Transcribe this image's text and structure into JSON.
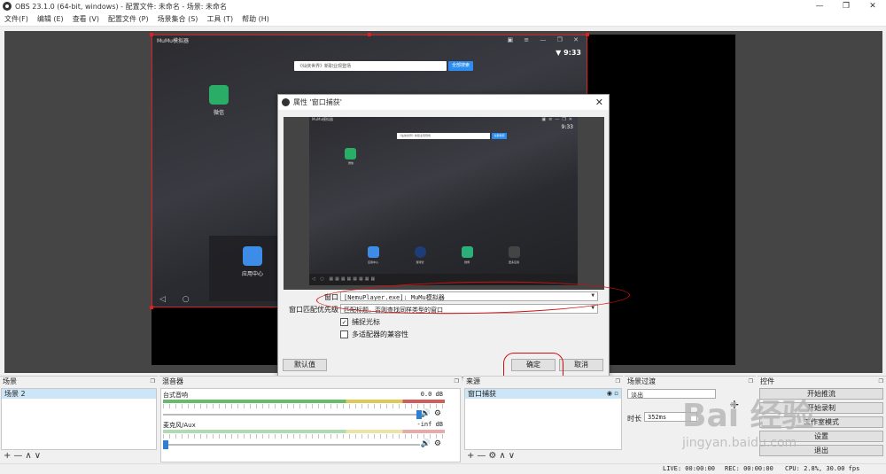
{
  "window": {
    "title": "OBS 23.1.0 (64-bit, windows) - 配置文件: 未命名 - 场景: 未命名"
  },
  "menu": [
    "文件(F)",
    "编辑 (E)",
    "查看 (V)",
    "配置文件 (P)",
    "场景集合 (S)",
    "工具 (T)",
    "帮助 (H)"
  ],
  "source_preview": {
    "app_title": "MuMu模拟器",
    "time": "9:33",
    "search_placeholder": "《仙侠世界》新职业现登场",
    "search_button": "全部搜索",
    "wechat_label": "微信",
    "app_center_label": "应用中心"
  },
  "dialog": {
    "title": "属性 '窗口捕获'",
    "window_label": "窗口",
    "window_value": "[NemuPlayer.exe]: MuMu模拟器",
    "priority_label": "窗口匹配优先级",
    "priority_value": "匹配标题，否则查找同样类型的窗口",
    "capture_cursor_label": "捕捉光标",
    "capture_cursor_checked": true,
    "multi_adapter_label": "多适配器的兼容性",
    "multi_adapter_checked": false,
    "defaults_button": "默认值",
    "ok_button": "确定",
    "cancel_button": "取消",
    "mini": {
      "time": "9:33",
      "search_placeholder": "《仙侠世界》新职业现登场",
      "search_button": "全部搜索",
      "wechat_label": "微信",
      "dock_labels": [
        "应用中心",
        "游戏管",
        "微博",
        "更多应用"
      ]
    }
  },
  "docks": {
    "scenes": {
      "title": "场景",
      "items": [
        "场景 2"
      ]
    },
    "mixer": {
      "title": "混音器",
      "channels": [
        {
          "name": "台式音响",
          "db": "0.0 dB"
        },
        {
          "name": "麦克风/Aux",
          "db": "-inf dB"
        }
      ]
    },
    "sources": {
      "title": "来源",
      "items": [
        "窗口捕获"
      ]
    },
    "transitions": {
      "title": "场景过渡",
      "type": "淡出",
      "duration_label": "时长",
      "duration_value": "352ms"
    },
    "controls": {
      "title": "控件",
      "buttons": [
        "开始推流",
        "开始录制",
        "工作室模式",
        "设置",
        "退出"
      ]
    }
  },
  "status": {
    "live": "LIVE: 00:00:00",
    "rec": "REC: 00:00:00",
    "cpu": "CPU: 2.8%, 30.00 fps"
  },
  "watermark": {
    "main": "Bai 经验",
    "sub": "jingyan.baidu.com"
  },
  "colors": {
    "accent": "#2d8cf0",
    "selection_border": "#e02020",
    "annotation": "#d01010"
  }
}
